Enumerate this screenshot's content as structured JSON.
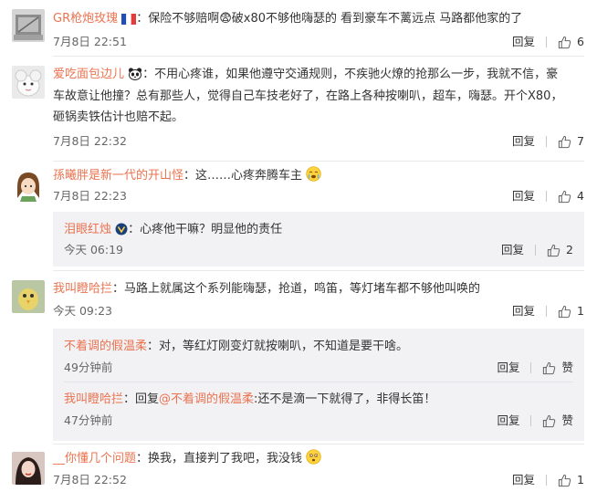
{
  "comments": [
    {
      "user": "GR枪炮玫瑰",
      "text": "：保险不够赔啊😨破x80不够他嗨瑟的 看到豪车不蓠远点 马路都他家的了",
      "time": "7月8日 22:51",
      "reply_label": "回复",
      "likes": "6",
      "badge": "france-flag-icon"
    },
    {
      "user": "爱吃面包边儿",
      "text_line1": "：不用心疼谁，如果他遵守交通规则，不疾驰火燎的抢那么一步，我就不信，豪",
      "text_line2": "车故意让他撞？总有那些人，觉得自己车技老好了，在路上各种按喇叭，超车，嗨瑟。开个X80，",
      "text_line3": "砸锅卖铁估计也赔不起。",
      "time": "7月8日 22:32",
      "reply_label": "回复",
      "likes": "7",
      "badge": "panda-icon"
    },
    {
      "user": "孫曦胖是新一代的开山怪",
      "text": "：这……心疼奔腾车主",
      "time": "7月8日 22:23",
      "reply_label": "回复",
      "likes": "4",
      "subs": [
        {
          "user": "泪眼红烛",
          "text": "：心疼他干嘛？明显他的责任",
          "time": "今天 06:19",
          "reply_label": "回复",
          "likes": "2",
          "badge": "vip-icon"
        }
      ]
    },
    {
      "user": "我叫瞪哈拦",
      "text": "：马路上就属这个系列能嗨瑟，抢道，鸣笛，等灯堵车都不够他叫唤的",
      "time": "今天 09:23",
      "reply_label": "回复",
      "likes": "1",
      "subs": [
        {
          "user": "不着调的假温柔",
          "text": "：对，等红灯刚变灯就按喇叭，不知道是要干啥。",
          "time": "49分钟前",
          "reply_label": "回复",
          "likes": "赞"
        },
        {
          "user": "我叫瞪哈拦",
          "text_prefix": "：回复",
          "mention": "@不着调的假温柔",
          "text_suffix": ":还不是滴一下就得了，非得长笛！",
          "time": "47分钟前",
          "reply_label": "回复",
          "likes": "赞"
        }
      ]
    },
    {
      "user": "__你懂几个问题",
      "text": "：换我，直接判了我吧，我没钱",
      "time": "7月8日 22:52",
      "reply_label": "回复",
      "likes": "1"
    }
  ],
  "colors": {
    "username": "#eb7350",
    "text": "#333333",
    "meta": "#666666",
    "subbox": "#f2f2f5"
  }
}
